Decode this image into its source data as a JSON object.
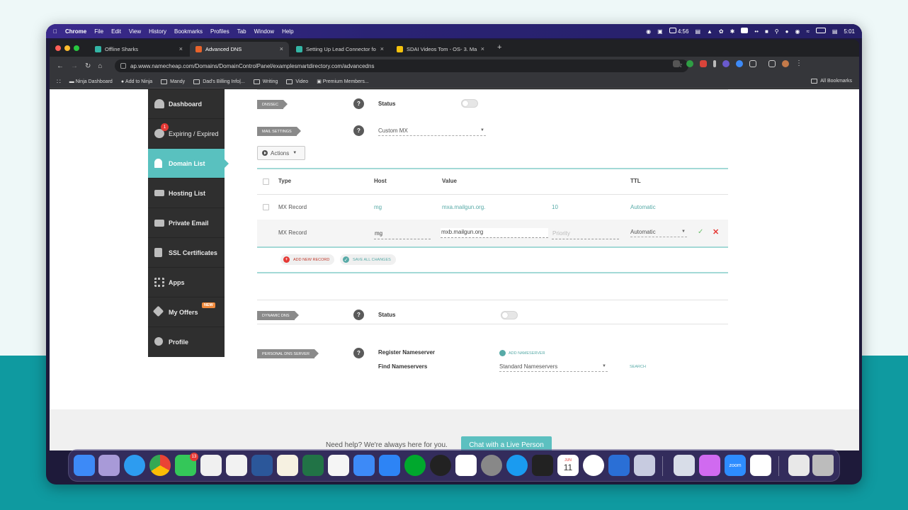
{
  "menubar": {
    "items": [
      "Chrome",
      "File",
      "Edit",
      "View",
      "History",
      "Bookmarks",
      "Profiles",
      "Tab",
      "Window",
      "Help"
    ],
    "clock_small": "4:56",
    "time": "5:01"
  },
  "browser": {
    "tabs": [
      {
        "title": "Offline Sharks",
        "icon_color": "#33b5a5"
      },
      {
        "title": "Advanced DNS",
        "icon_color": "#e8632b"
      },
      {
        "title": "Setting Up Lead Connector fo",
        "icon_color": "#33b5a5"
      },
      {
        "title": "SDAI Videos Tom - OS- 3. Ma",
        "icon_color": "#f4c20d"
      }
    ],
    "url": "ap.www.namecheap.com/Domains/DomainControlPanel/examplesmartdirectory.com/advancedns",
    "bookmarks": [
      "Ninja Dashboard",
      "Add to Ninja",
      "Mandy",
      "Dad's Billing Info|...",
      "Writing",
      "Video",
      "Premium Members..."
    ],
    "all_bookmarks": "All Bookmarks"
  },
  "sidebar": {
    "items": [
      {
        "label": "Dashboard",
        "icon": "gauge-icon"
      },
      {
        "label": "Expiring / Expired",
        "icon": "alarm-clock-icon",
        "badge": "1"
      },
      {
        "label": "Domain List",
        "icon": "home-icon"
      },
      {
        "label": "Hosting List",
        "icon": "server-icon"
      },
      {
        "label": "Private Email",
        "icon": "envelope-icon"
      },
      {
        "label": "SSL Certificates",
        "icon": "lock-icon"
      },
      {
        "label": "Apps",
        "icon": "apps-grid-icon"
      },
      {
        "label": "My Offers",
        "icon": "tag-icon",
        "badge": "NEW"
      },
      {
        "label": "Profile",
        "icon": "gear-icon"
      }
    ],
    "active_color": "#59c1bf"
  },
  "dns": {
    "dnssec": {
      "tag": "DNSSEC",
      "label": "Status"
    },
    "mail": {
      "tag": "MAIL SETTINGS",
      "value": "Custom MX"
    },
    "actions_label": "Actions",
    "columns": [
      "Type",
      "Host",
      "Value",
      "TTL"
    ],
    "rows": [
      {
        "type": "MX Record",
        "host": "mg",
        "value": "mxa.mailgun.org.",
        "priority": "10",
        "ttl": "Automatic"
      }
    ],
    "edit_row": {
      "type": "MX Record",
      "host": "mg",
      "value": "mxb.mailgun.org",
      "priority_placeholder": "Priority",
      "ttl": "Automatic"
    },
    "add_record": "ADD NEW RECORD",
    "save_all": "SAVE ALL CHANGES",
    "dynamic": {
      "tag": "DYNAMIC DNS",
      "label": "Status"
    },
    "personal": {
      "tag": "PERSONAL DNS SERVER",
      "register_label": "Register Nameserver",
      "add_nameserver": "ADD NAMESERVER",
      "find_label": "Find Nameservers",
      "find_value": "Standard Nameservers",
      "search": "SEARCH"
    }
  },
  "footer": {
    "help": "Need help? We're always here for you.",
    "chat": "Chat with a Live Person"
  },
  "dock": {
    "calendar_month": "JUN",
    "calendar_day": "11",
    "messages_badge": "13",
    "zoom_label": "zoom"
  }
}
